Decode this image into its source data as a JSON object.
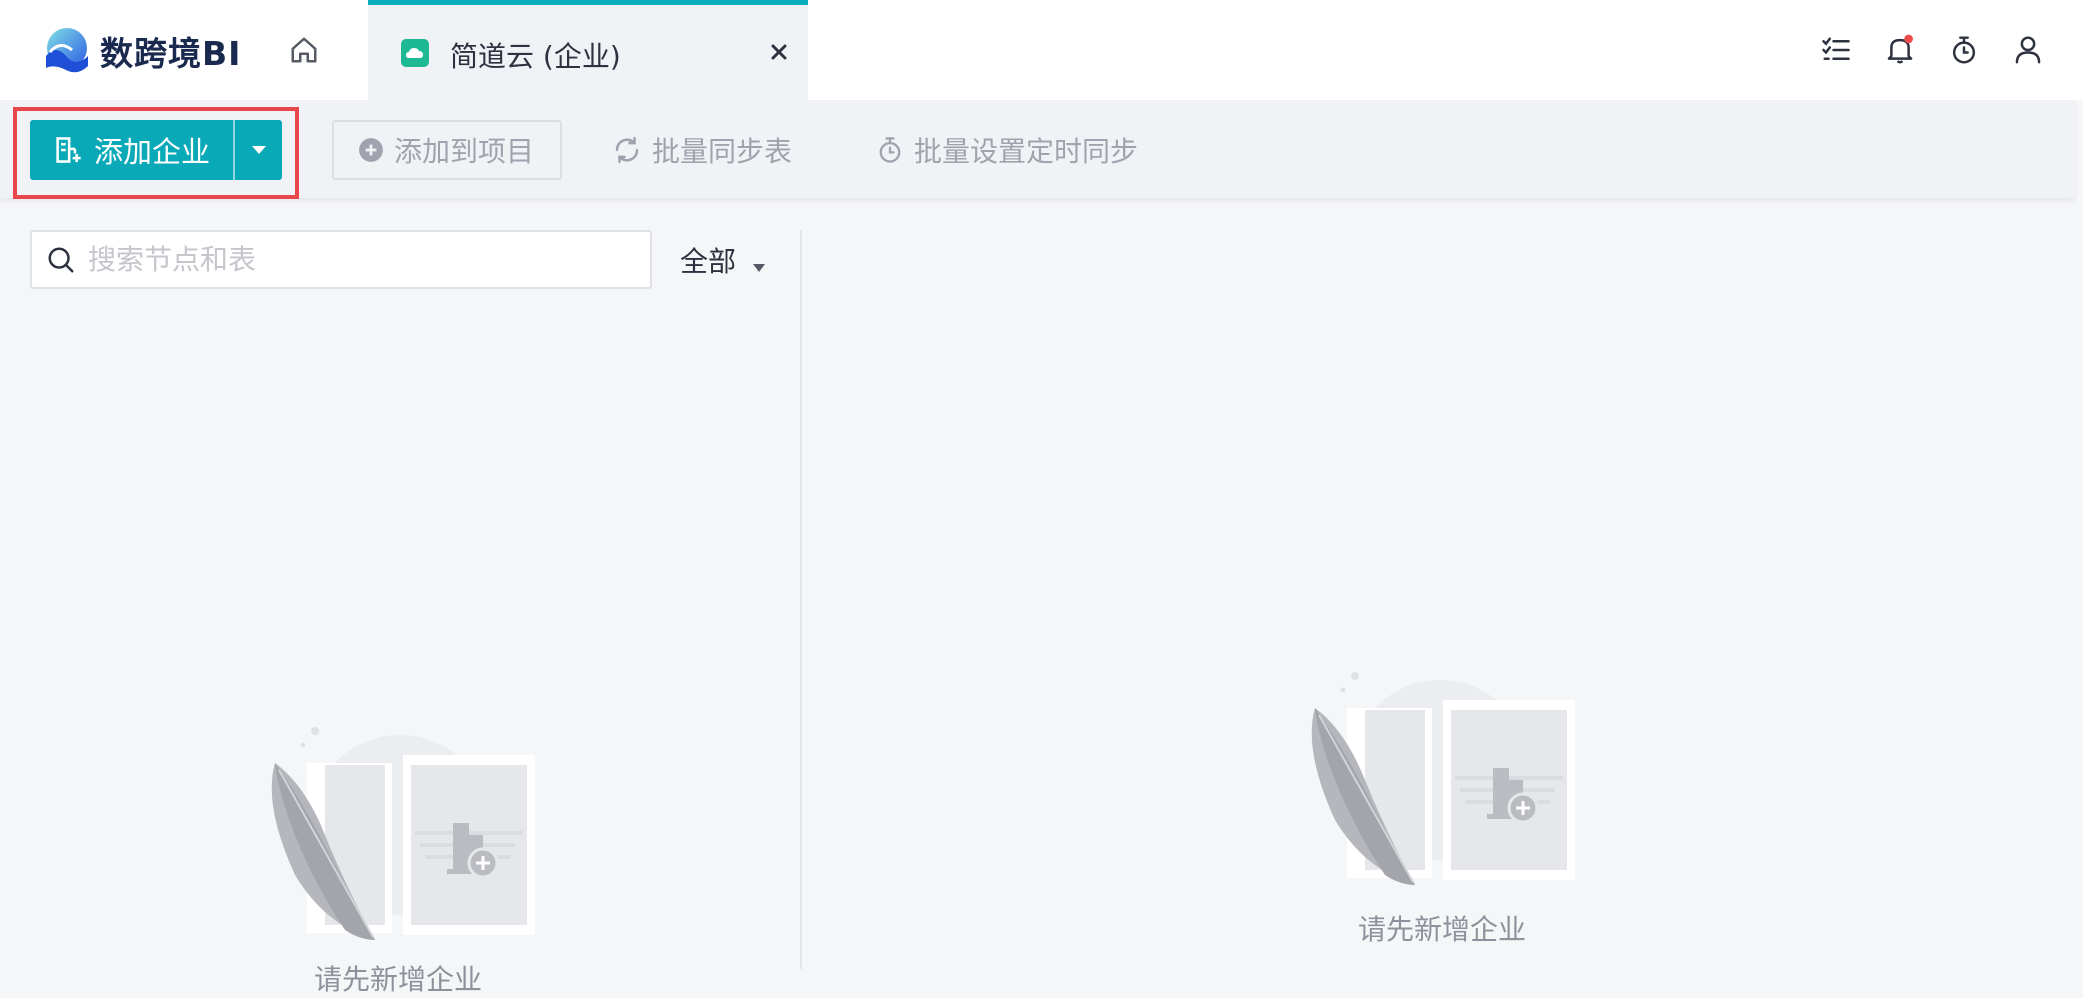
{
  "app": {
    "logo_text": "数跨境BI"
  },
  "tabs": [
    {
      "label": "简道云 (企业)",
      "close": "×"
    }
  ],
  "toolbar": {
    "add_company_label": "添加企业",
    "add_to_project_label": "添加到项目",
    "batch_sync_label": "批量同步表",
    "batch_timer_label": "批量设置定时同步"
  },
  "search": {
    "placeholder": "搜索节点和表",
    "value": ""
  },
  "filter": {
    "selected": "全部"
  },
  "empty_state": {
    "left_message": "请先新增企业",
    "right_message": "请先新增企业"
  },
  "icons": {
    "home": "home-icon",
    "tab": "cloud-app-icon",
    "tasks": "task-list-icon",
    "notifications": "bell-icon",
    "timer": "timer-icon",
    "user": "user-icon",
    "add_company": "building-add-icon",
    "add_to_project": "plus-circle-icon",
    "sync": "sync-icon",
    "schedule": "stopwatch-icon",
    "search": "search-icon"
  },
  "colors": {
    "primary": "#0aa9b7",
    "tab_accent": "#0ab0c0",
    "highlight": "#e8474c",
    "notification_dot": "#f04b4b",
    "logo_text": "#1a2a4f"
  }
}
